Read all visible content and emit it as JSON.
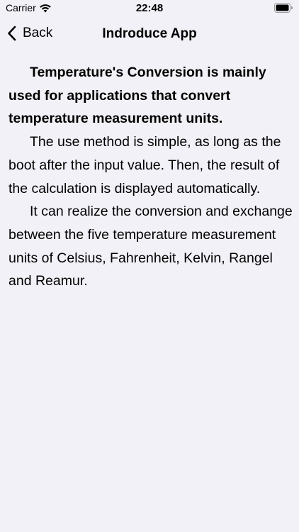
{
  "status_bar": {
    "carrier": "Carrier",
    "time": "22:48"
  },
  "nav": {
    "back_label": "Back",
    "title": "Indroduce App"
  },
  "content": {
    "paragraphs": [
      "Temperature's Conversion is mainly used for applications that convert temperature measurement units.",
      "The use method is simple, as long as the boot after the input value. Then, the result of the calculation is displayed automatically.",
      "It can realize the conversion and exchange between the five temperature measurement units of Celsius, Fahrenheit, Kelvin, Rangel and Reamur."
    ]
  },
  "colors": {
    "background": "#f2f1f7",
    "text": "#000000"
  },
  "icons": [
    "wifi-icon",
    "battery-icon",
    "chevron-left-icon"
  ]
}
